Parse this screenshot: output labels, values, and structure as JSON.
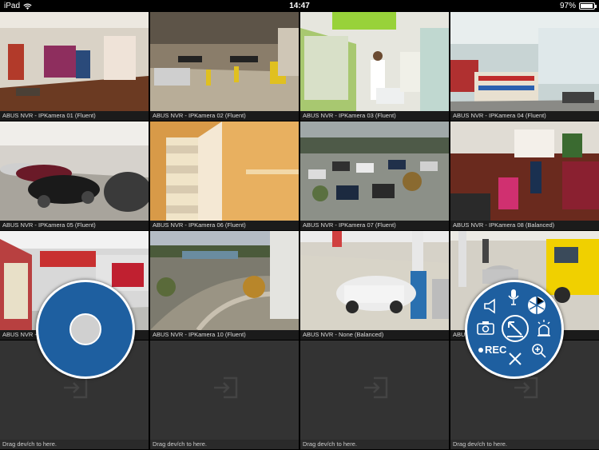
{
  "status_bar": {
    "device": "iPad",
    "time": "14:47",
    "battery": "97%"
  },
  "cameras": [
    {
      "caption": "ABUS NVR - IPKamera 01 (Fluent)"
    },
    {
      "caption": "ABUS NVR - IPKamera 02 (Fluent)"
    },
    {
      "caption": "ABUS NVR - IPKamera 03 (Fluent)"
    },
    {
      "caption": "ABUS NVR - IPKamera 04 (Fluent)"
    },
    {
      "caption": "ABUS NVR - IPKamera 05 (Fluent)"
    },
    {
      "caption": "ABUS NVR - IPKamera 06 (Fluent)"
    },
    {
      "caption": "ABUS NVR - IPKamera 07 (Fluent)"
    },
    {
      "caption": "ABUS NVR - IPKamera 08 (Balanced)"
    },
    {
      "caption": "ABUS NVR - IPKamera 09 (Fluent)"
    },
    {
      "caption": "ABUS NVR - IPKamera 10 (Fluent)"
    },
    {
      "caption": "ABUS NVR - None (Balanced)"
    },
    {
      "caption": "ABUS NVR - IPKamera 12 (Fluent)"
    }
  ],
  "empty_slots": [
    {
      "caption": "Drag dev/ch to here."
    },
    {
      "caption": "Drag dev/ch to here."
    },
    {
      "caption": "Drag dev/ch to here."
    },
    {
      "caption": "Drag dev/ch to here."
    }
  ],
  "ptz_menu": {
    "rec_label": "REC"
  },
  "colors": {
    "accent": "#1e5fa0",
    "selected_border": "#3a4fc0"
  }
}
